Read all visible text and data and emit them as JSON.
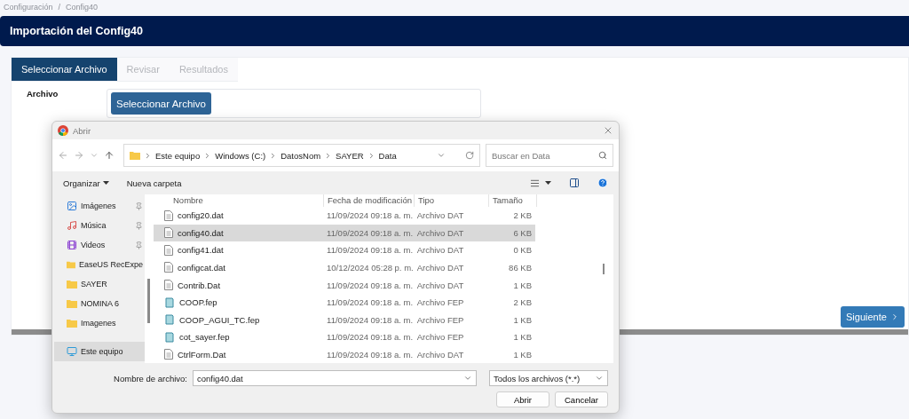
{
  "breadcrumb": {
    "items": [
      "Configuración",
      "Config40"
    ],
    "separator": "/"
  },
  "header": {
    "title": "Importación del Config40"
  },
  "tabs": [
    {
      "label": "Seleccionar Archivo",
      "selected": true
    },
    {
      "label": "Revisar",
      "selected": false
    },
    {
      "label": "Resultados",
      "selected": false
    }
  ],
  "form": {
    "label": "Archivo",
    "button": "Seleccionar Archivo"
  },
  "next_button": "Siguiente",
  "dialog": {
    "title": "Abrir",
    "address": [
      "Este equipo",
      "Windows (C:)",
      "DatosNom",
      "SAYER",
      "Data"
    ],
    "search": {
      "placeholder": "Buscar en Data"
    },
    "toolbar": {
      "organize": "Organizar",
      "new_folder": "Nueva carpeta"
    },
    "sidebar": [
      {
        "label": "Imágenes",
        "kind": "images",
        "pinned": true
      },
      {
        "label": "Música",
        "kind": "music",
        "pinned": true
      },
      {
        "label": "Videos",
        "kind": "videos",
        "pinned": true
      },
      {
        "label": "EaseUS RecExpe",
        "kind": "folder",
        "pinned": false
      },
      {
        "label": "SAYER",
        "kind": "folder",
        "pinned": false
      },
      {
        "label": "NOMINA 6",
        "kind": "folder",
        "pinned": false
      },
      {
        "label": "Imagenes",
        "kind": "folder",
        "pinned": false
      },
      {
        "label": "Este equipo",
        "kind": "computer",
        "pinned": false
      }
    ],
    "columns": [
      "Nombre",
      "Fecha de modificación",
      "Tipo",
      "Tamaño"
    ],
    "files": [
      {
        "name": "config20.dat",
        "date": "11/09/2024 09:18 a. m.",
        "type": "Archivo DAT",
        "size": "2 KB",
        "kind": "dat",
        "selected": false
      },
      {
        "name": "config40.dat",
        "date": "11/09/2024 09:18 a. m.",
        "type": "Archivo DAT",
        "size": "6 KB",
        "kind": "dat",
        "selected": true
      },
      {
        "name": "config41.dat",
        "date": "11/09/2024 09:18 a. m.",
        "type": "Archivo DAT",
        "size": "0 KB",
        "kind": "dat",
        "selected": false
      },
      {
        "name": "configcat.dat",
        "date": "10/12/2024 05:28 p. m.",
        "type": "Archivo DAT",
        "size": "86 KB",
        "kind": "dat",
        "selected": false
      },
      {
        "name": "Contrib.Dat",
        "date": "11/09/2024 09:18 a. m.",
        "type": "Archivo DAT",
        "size": "1 KB",
        "kind": "dat",
        "selected": false
      },
      {
        "name": "COOP.fep",
        "date": "11/09/2024 09:18 a. m.",
        "type": "Archivo FEP",
        "size": "2 KB",
        "kind": "fep",
        "selected": false
      },
      {
        "name": "COOP_AGUI_TC.fep",
        "date": "11/09/2024 09:18 a. m.",
        "type": "Archivo FEP",
        "size": "1 KB",
        "kind": "fep",
        "selected": false
      },
      {
        "name": "cot_sayer.fep",
        "date": "11/09/2024 09:18 a. m.",
        "type": "Archivo FEP",
        "size": "1 KB",
        "kind": "fep",
        "selected": false
      },
      {
        "name": "CtrlForm.Dat",
        "date": "11/09/2024 09:18 a. m.",
        "type": "Archivo DAT",
        "size": "1 KB",
        "kind": "dat",
        "selected": false
      }
    ],
    "filename": {
      "label": "Nombre de archivo:",
      "value": "config40.dat"
    },
    "filter": "Todos los archivos (*.*)",
    "buttons": [
      "Abrir",
      "Cancelar"
    ]
  }
}
